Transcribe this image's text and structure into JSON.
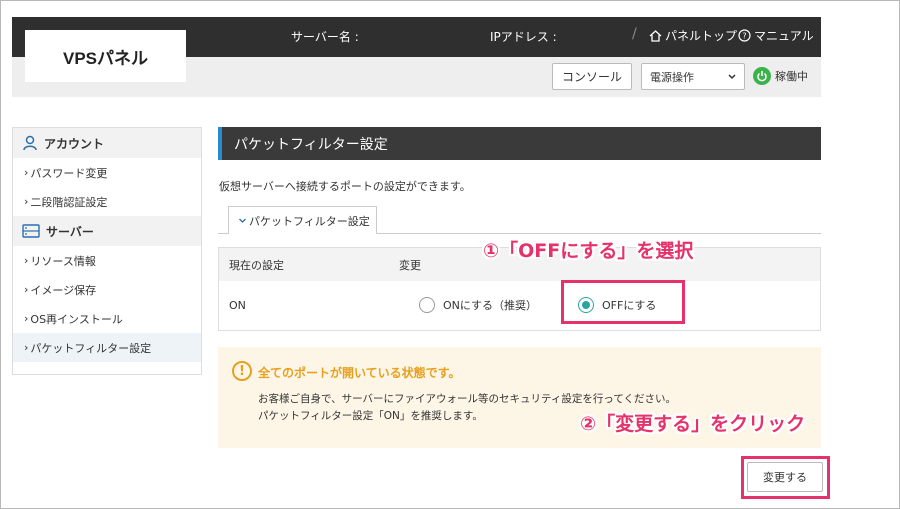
{
  "header": {
    "logo": "VPSパネル",
    "server_name_label": "サーバー名 :",
    "ip_label": "IPアドレス :",
    "separator": "/",
    "panel_top": "パネルトップ",
    "manual": "マニュアル"
  },
  "toolbar": {
    "console_label": "コンソール",
    "power_select_value": "電源操作",
    "status_text": "稼働中"
  },
  "sidebar": {
    "account_heading": "アカウント",
    "account_items": [
      {
        "label": "パスワード変更"
      },
      {
        "label": "二段階認証設定"
      }
    ],
    "server_heading": "サーバー",
    "server_items": [
      {
        "label": "リソース情報"
      },
      {
        "label": "イメージ保存"
      },
      {
        "label": "OS再インストール"
      },
      {
        "label": "パケットフィルター設定"
      }
    ]
  },
  "main": {
    "title": "パケットフィルター設定",
    "description": "仮想サーバーへ接続するポートの設定ができます。",
    "tab_label": "パケットフィルター設定",
    "table": {
      "col_current": "現在の設定",
      "col_change": "変更",
      "current_value": "ON",
      "option_on": "ONにする（推奨）",
      "option_off": "OFFにする",
      "selected": "OFFにする"
    },
    "warning": {
      "title": "全てのポートが開いている状態です。",
      "line1": "お客様ご自身で、サーバーにファイアウォール等のセキュリティ設定を行ってください。",
      "line2": "パケットフィルター設定「ON」を推奨します。"
    },
    "submit_label": "変更する"
  },
  "annotations": {
    "step1": "①「OFFにする」を選択",
    "step2": "②「変更する」をクリック"
  },
  "colors": {
    "accent_pink": "#e6316a",
    "radio_selected": "#2ba3a3",
    "warning_orange": "#e6a020",
    "status_green": "#3cb34a",
    "title_border": "#2a8cd0"
  }
}
